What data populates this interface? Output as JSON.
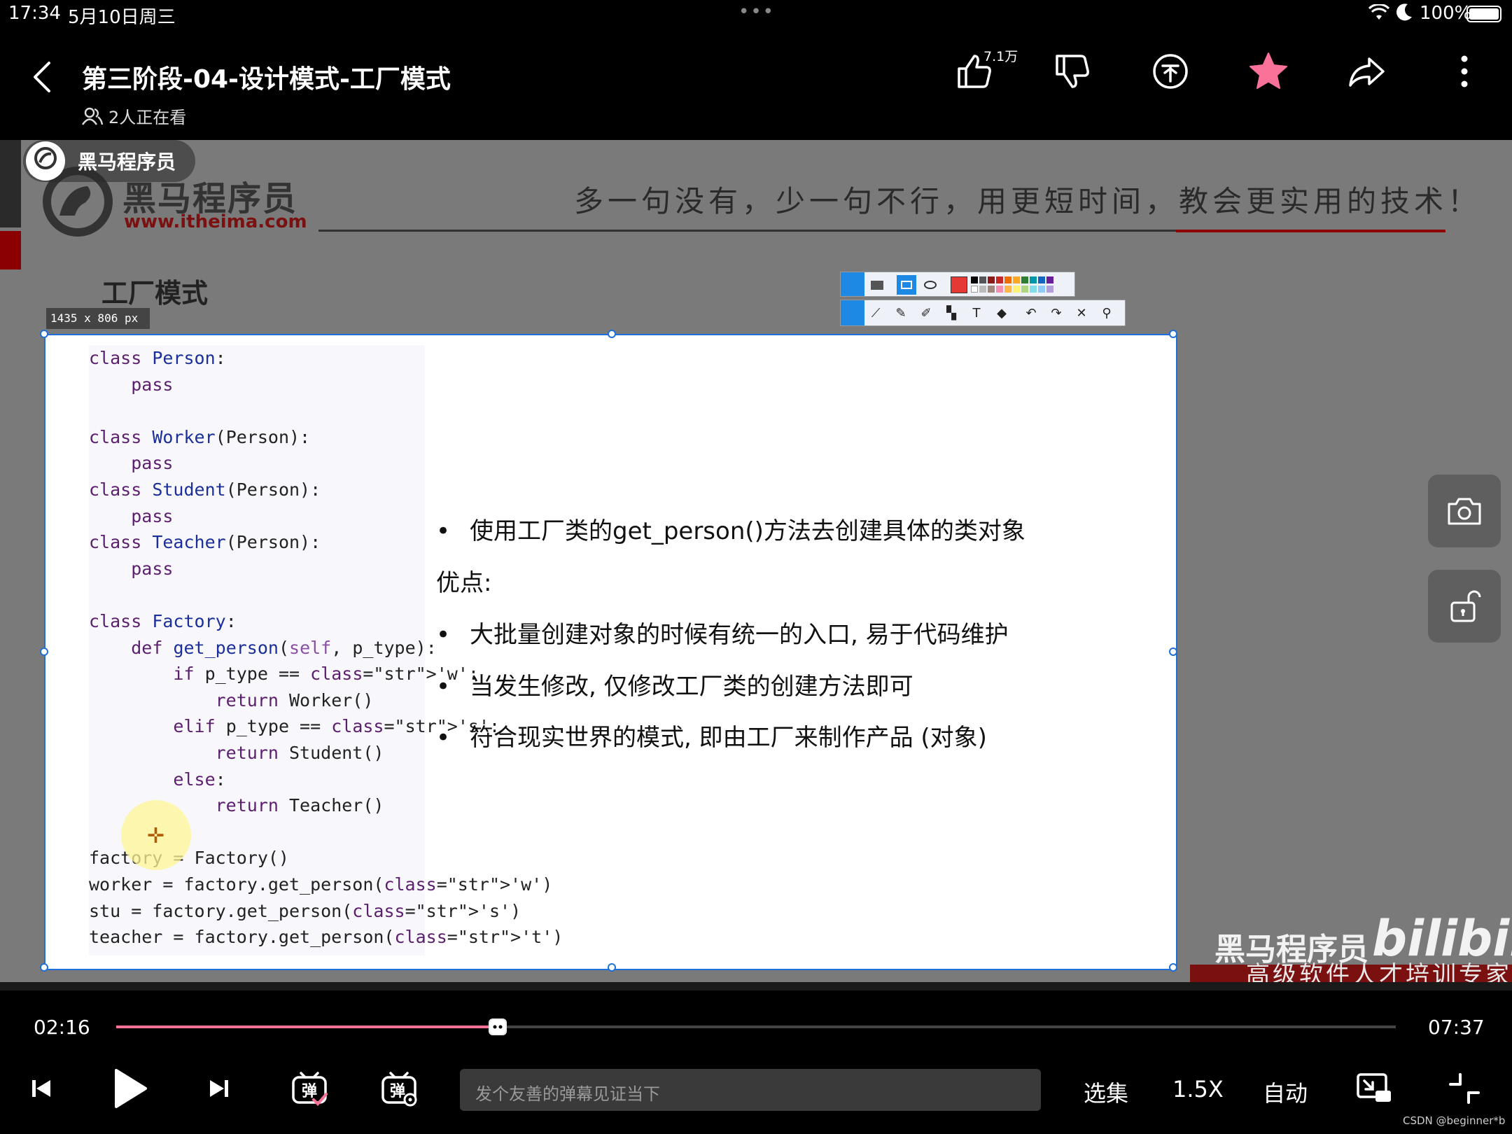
{
  "status_bar": {
    "time": "17:34",
    "date": "5月10日周三",
    "battery": "100%",
    "battery_level": 1.0
  },
  "header": {
    "back_icon": "chevron-left-icon",
    "title": "第三阶段-04-设计模式-工厂模式",
    "viewers": "2人正在看",
    "like_count": "7.1万",
    "icons": [
      "thumb-up-icon",
      "thumb-down-icon",
      "coin-icon",
      "star-icon",
      "share-icon",
      "more-icon"
    ],
    "favorite_color": "#fb7299"
  },
  "video": {
    "channel_name": "黑马程序员",
    "logo_cn": "黑马程序员",
    "logo_url": "www.itheima.com",
    "slogan": "多一句没有，少一句不行，用更短时间，教会更实用的技术！",
    "slide_title": "工厂模式",
    "dimension_label": "1435 x 806  px",
    "code": [
      "class Person:",
      "    pass",
      "",
      "class Worker(Person):",
      "    pass",
      "class Student(Person):",
      "    pass",
      "class Teacher(Person):",
      "    pass",
      "",
      "class Factory:",
      "    def get_person(self, p_type):",
      "        if p_type == 'w':",
      "            return Worker()",
      "        elif p_type == 's':",
      "            return Student()",
      "        else:",
      "            return Teacher()",
      "",
      "factory = Factory()",
      "worker = factory.get_person('w')",
      "stu = factory.get_person('s')",
      "teacher = factory.get_person('t')"
    ],
    "bullets": {
      "first": "使用工厂类的get_person()方法去创建具体的类对象",
      "advantages_title": "优点:",
      "items": [
        "大批量创建对象的时候有统一的入口, 易于代码维护",
        "当发生修改, 仅修改工厂类的创建方法即可",
        "符合现实世界的模式, 即由工厂来制作产品 (对象)"
      ]
    },
    "watermark_cn": "黑马程序员",
    "watermark_bili": "bilibili",
    "watermark_sub": "高级软件人才培训专家",
    "side_buttons": [
      "camera-icon",
      "unlock-icon"
    ]
  },
  "controls": {
    "current_time": "02:16",
    "duration": "07:37",
    "progress": 0.298,
    "danmaku_placeholder": "发个友善的弹幕见证当下",
    "episodes": "选集",
    "speed": "1.5X",
    "quality": "自动",
    "icons": [
      "skip-previous-icon",
      "play-icon",
      "skip-next-icon",
      "danmaku-on-icon",
      "danmaku-settings-icon",
      "pip-icon",
      "exit-fullscreen-icon"
    ],
    "accent": "#fb7299"
  },
  "footer_watermark": "CSDN @beginner*b"
}
